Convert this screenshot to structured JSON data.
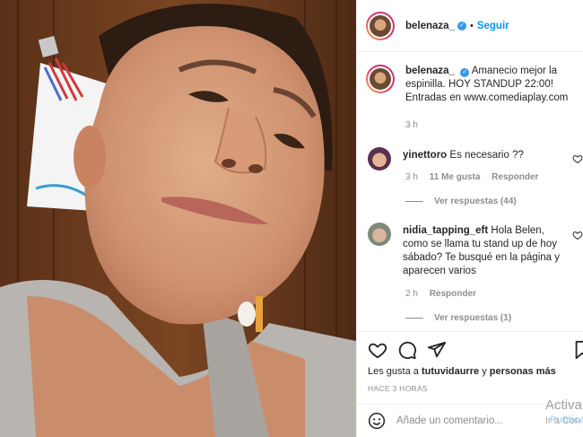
{
  "post": {
    "author": "belenaza_",
    "follow_label": "Seguir",
    "separator": "•",
    "verified_mark": "✓"
  },
  "caption": {
    "author": "belenaza_",
    "text": "Amanecio mejor la espinilla. HOY STANDUP 22:00! Entradas en www.comediaplay.com",
    "time": "3 h"
  },
  "comments": [
    {
      "user": "yinettoro",
      "text": "Es necesario ??",
      "time": "3 h",
      "likes": "11 Me gusta",
      "reply_label": "Responder",
      "view_replies": "Ver respuestas (44)"
    },
    {
      "user": "nidia_tapping_eft",
      "text": "Hola Belen, como se llama tu stand up de hoy sábado? Te busqué en la página y aparecen varios",
      "time": "2 h",
      "reply_label": "Responder",
      "view_replies": "Ver respuestas (1)"
    }
  ],
  "likes": {
    "prefix": "Les gusta a",
    "user": "tutuvidaurre",
    "connector": "y",
    "others": "personas más"
  },
  "date": "HACE 3 HORAS",
  "add_comment": {
    "placeholder": "Añade un comentario...",
    "publish_label": "Publicar"
  },
  "watermark": {
    "line1": "Activa",
    "line2": "Ir a Con"
  },
  "icons": {
    "heart": "heart-icon",
    "comment": "comment-icon",
    "share": "share-icon",
    "save": "bookmark-icon",
    "emoji": "emoji-icon"
  },
  "colors": {
    "link_blue": "#0095f6",
    "verified_blue": "#3897f0",
    "muted": "#8e8e8e"
  }
}
